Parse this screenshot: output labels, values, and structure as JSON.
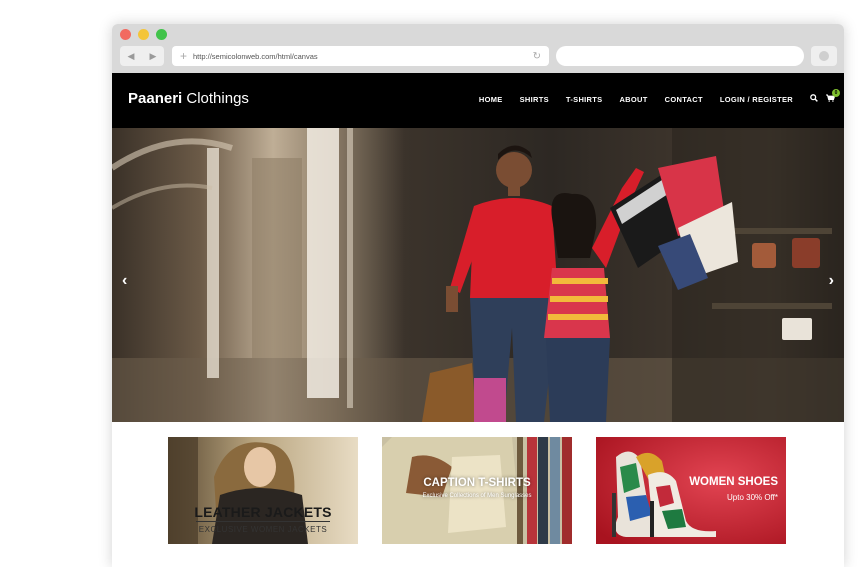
{
  "browser": {
    "url": "http://semicolonweb.com/html/canvas",
    "back_glyph": "◀",
    "forward_glyph": "▶",
    "plus_glyph": "+",
    "reload_glyph": "↻"
  },
  "site": {
    "logo_bold": "Paaneri",
    "logo_rest": " Clothings",
    "nav": [
      "HOME",
      "SHIRTS",
      "T-SHIRTS",
      "ABOUT",
      "CONTACT",
      "LOGIN / REGISTER"
    ],
    "search_icon": "search-icon",
    "cart_icon": "cart-icon",
    "cart_count": "0"
  },
  "slider": {
    "prev_glyph": "‹",
    "next_glyph": "›"
  },
  "tiles": [
    {
      "title": "LEATHER JACKETS",
      "subtitle": "EXCLUSIVE WOMEN JACKETS"
    },
    {
      "title": "CAPTION T-SHIRTS",
      "subtitle": "Exclusive Collections of Men Sunglasses"
    },
    {
      "title": "WOMEN SHOES",
      "subtitle": "Upto 30% Off*"
    }
  ],
  "colors": {
    "header_bg": "#000000",
    "cart_badge": "#7fbf2f",
    "shoes_bg": "#c4242f"
  }
}
